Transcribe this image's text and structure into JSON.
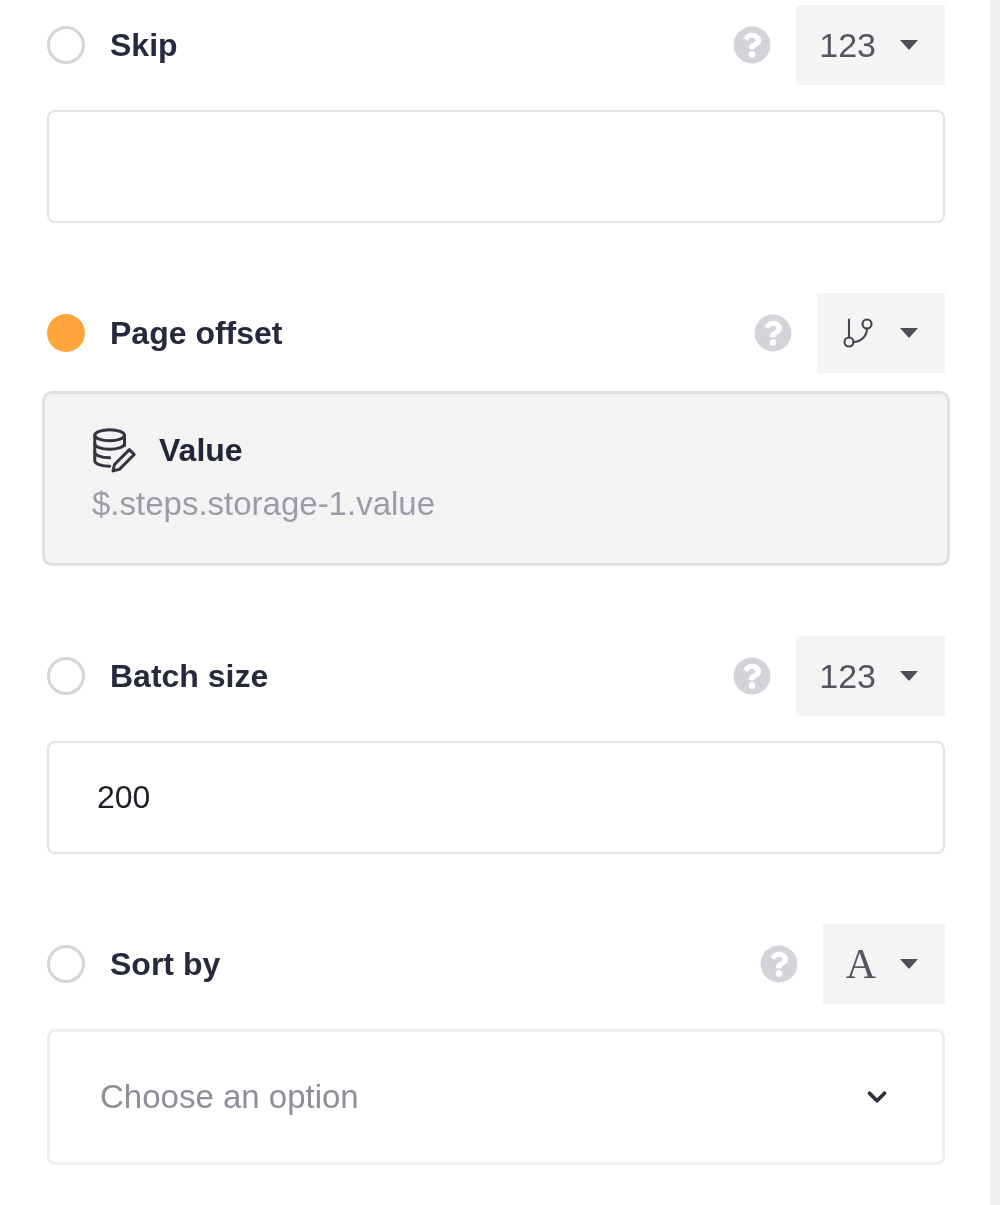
{
  "fields": [
    {
      "label": "Skip",
      "selected": false,
      "type_button": {
        "kind": "number",
        "label": "123"
      },
      "control": {
        "kind": "input"
      }
    },
    {
      "label": "Page offset",
      "selected": true,
      "type_button": {
        "kind": "reference"
      },
      "control": {
        "kind": "reference",
        "title": "Value",
        "path": "$.steps.storage-1.value"
      }
    },
    {
      "label": "Batch size",
      "selected": false,
      "type_button": {
        "kind": "number",
        "label": "123"
      },
      "control": {
        "kind": "input",
        "value": "200"
      }
    },
    {
      "label": "Sort by",
      "selected": false,
      "type_button": {
        "kind": "text",
        "label": "A"
      },
      "control": {
        "kind": "select",
        "placeholder": "Choose an option"
      }
    }
  ]
}
